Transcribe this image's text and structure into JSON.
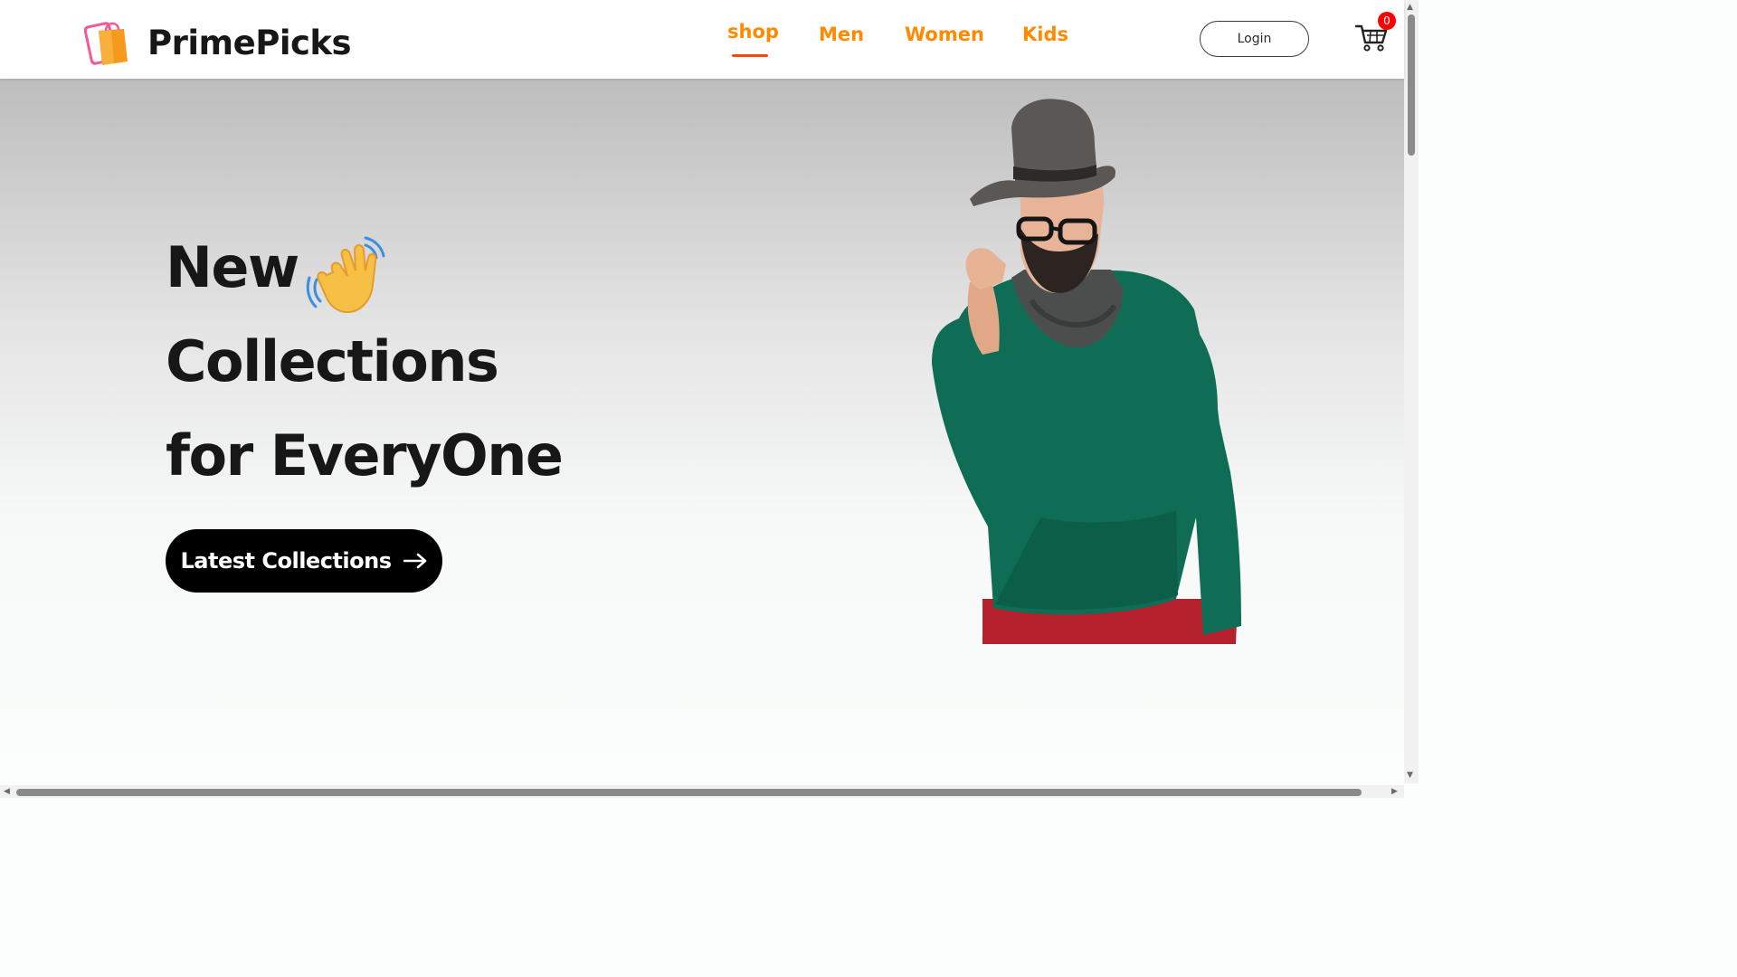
{
  "brand": {
    "name": "PrimePicks",
    "logo_icon": "shopping-bag-logo-icon"
  },
  "nav": {
    "items": [
      {
        "label": "shop",
        "active": true
      },
      {
        "label": "Men",
        "active": false
      },
      {
        "label": "Women",
        "active": false
      },
      {
        "label": "Kids",
        "active": false
      }
    ],
    "active_color": "#ff8a00",
    "underline_color": "#ff4500"
  },
  "header": {
    "login_label": "Login",
    "cart_icon": "cart-icon",
    "cart_count": "0"
  },
  "hero": {
    "line1": "New",
    "line2": "Collections",
    "line3": "for EveryOne",
    "wave_icon": "waving-hand-icon",
    "cta_label": "Latest Collections",
    "cta_icon": "arrow-right-icon",
    "image": "man-in-hat-green-sweater-photo"
  }
}
